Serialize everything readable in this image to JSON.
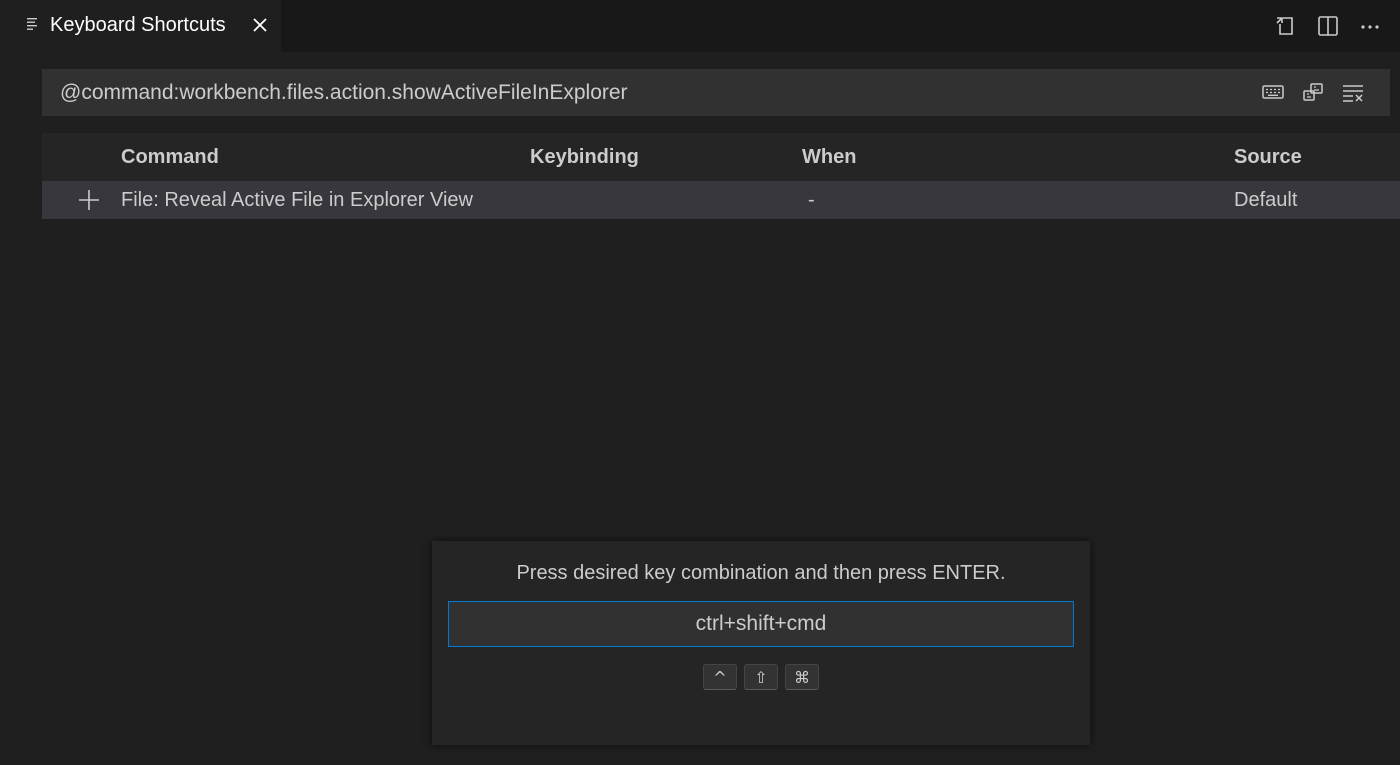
{
  "tab": {
    "title": "Keyboard Shortcuts",
    "icon": "list-icon",
    "close_icon": "close-icon"
  },
  "editor_actions": [
    "open-json-icon",
    "split-editor-icon",
    "more-actions-icon"
  ],
  "search": {
    "value": "@command:workbench.files.action.showActiveFileInExplorer",
    "actions": [
      "record-keys-icon",
      "sort-by-precedence-icon",
      "clear-search-icon"
    ]
  },
  "table": {
    "headers": {
      "command": "Command",
      "keybinding": "Keybinding",
      "when": "When",
      "source": "Source"
    },
    "rows": [
      {
        "command": "File: Reveal Active File in Explorer View",
        "keybinding": "",
        "when": "-",
        "source": "Default"
      }
    ]
  },
  "keybinding_widget": {
    "message": "Press desired key combination and then press ENTER.",
    "value": "ctrl+shift+cmd",
    "keys": [
      "^",
      "⇧",
      "⌘"
    ]
  },
  "colors": {
    "focus_border": "#0078d4",
    "background": "#1f1f1f",
    "row_selected": "#37373d"
  }
}
